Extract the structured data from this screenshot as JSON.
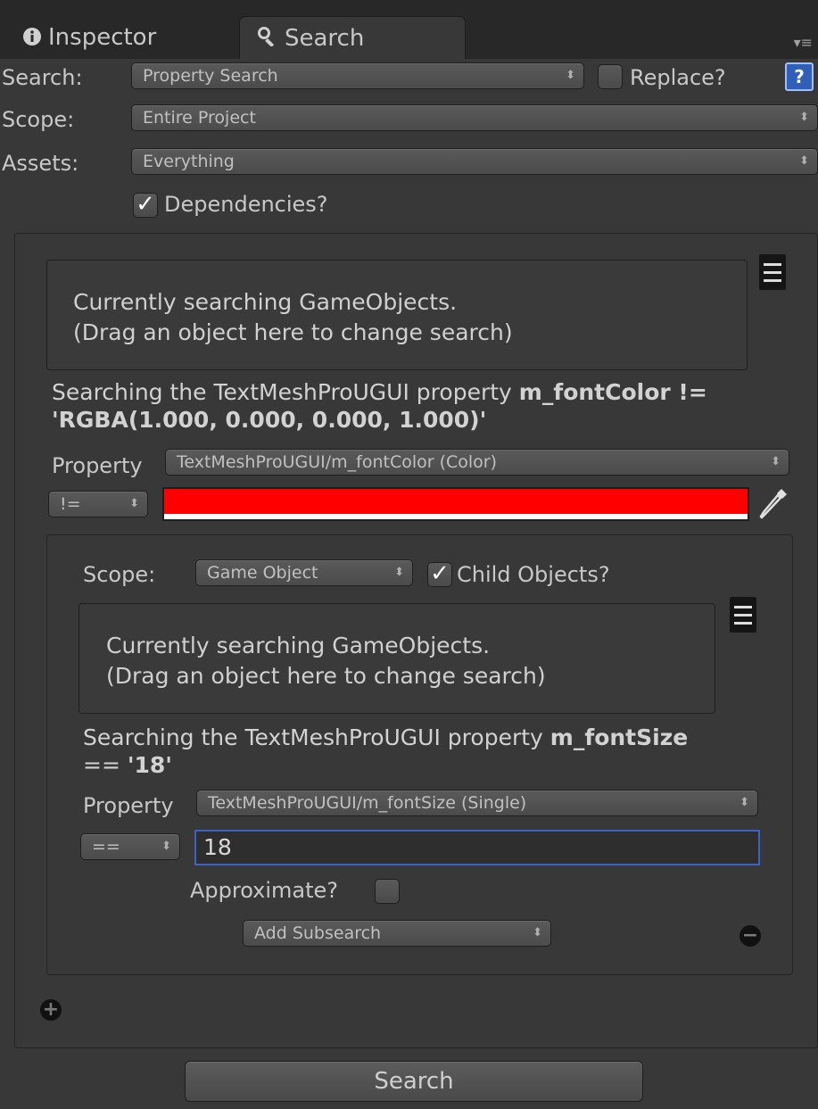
{
  "tabs": {
    "inspector": "Inspector",
    "search": "Search"
  },
  "header": {
    "search_label": "Search:",
    "search_value": "Property Search",
    "replace_label": "Replace?",
    "scope_label": "Scope:",
    "scope_value": "Entire Project",
    "assets_label": "Assets:",
    "assets_value": "Everything",
    "dependencies_label": "Dependencies?"
  },
  "outer_search": {
    "target_line1": "Currently searching GameObjects.",
    "target_line2": "(Drag an object here to change search)",
    "desc_prefix": "Searching the TextMeshProUGUI property ",
    "desc_bold_line1": "m_fontColor !=",
    "desc_bold_line2": "'RGBA(1.000, 0.000, 0.000, 1.000)'",
    "property_label": "Property",
    "property_value": "TextMeshProUGUI/m_fontColor (Color)",
    "operator_value": "!=",
    "color_value": "#ff0000"
  },
  "sub_search": {
    "scope_label": "Scope:",
    "scope_value": "Game Object",
    "child_objects_label": "Child Objects?",
    "target_line1": "Currently searching GameObjects.",
    "target_line2": "(Drag an object here to change search)",
    "desc_prefix": "Searching the TextMeshProUGUI property ",
    "desc_bold_line1": "m_fontSize",
    "desc_line2_plain": "== ",
    "desc_bold_line2": "'18'",
    "property_label": "Property",
    "property_value": "TextMeshProUGUI/m_fontSize (Single)",
    "operator_value": "==",
    "input_value": "18",
    "approximate_label": "Approximate?",
    "add_subsearch_label": "Add Subsearch"
  },
  "footer": {
    "search_button": "Search"
  }
}
